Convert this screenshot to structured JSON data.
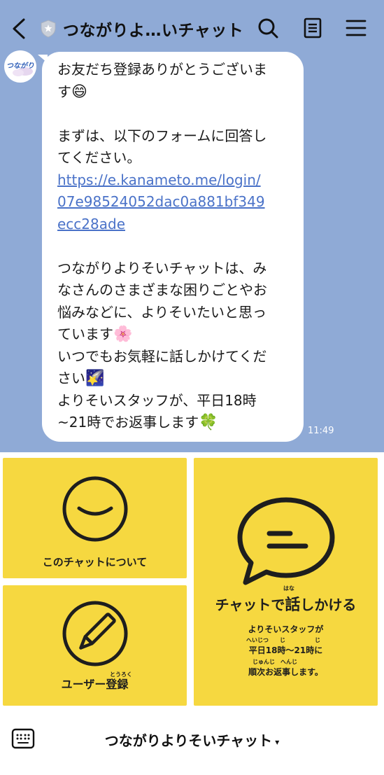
{
  "header": {
    "title": "つながりよ…いチャット"
  },
  "avatar": {
    "text": "つながり"
  },
  "message": {
    "line_greeting": "お友だち登録ありがとうございま",
    "line_greeting_2": "す",
    "line_form_1": "まずは、以下のフォームに回答し",
    "line_form_2": "てください。",
    "link_1": "https://e.kanameto.me/login/",
    "link_2": "07e98524052dac0a881bf349",
    "link_3": "ecc28ade",
    "line_p1": "つながりよりそいチャットは、み",
    "line_p2": "なさんのさまざまな困りごとやお",
    "line_p3": "悩みなどに、よりそいたいと思っ",
    "line_p4": "ています",
    "line_p5": "いつでもお気軽に話しかけてくだ",
    "line_p6": "さい",
    "line_p7": "よりそいスタッフが、平日18時",
    "line_p8": "~21時でお返事します",
    "time": "11:49"
  },
  "menu": {
    "about": {
      "label": "このチャットについて"
    },
    "register": {
      "label": "ユーザー登録",
      "ruby": "とうろく"
    },
    "talk": {
      "label_a": "チャットで",
      "label_b": "話",
      "label_c": "しかける",
      "ruby_b": "はな",
      "sub_1": "よりそいスタッフが",
      "sub_2": "平日18時～21時に",
      "sub_3": "順次お返事します。",
      "ruby_heijitsu": "へいじつ",
      "ruby_ji1": "じ",
      "ruby_ji2": "じ",
      "ruby_junji": "じゅんじ",
      "ruby_henji": "へんじ"
    }
  },
  "bottom": {
    "title": "つながりよりそいチャット",
    "caret": "▾"
  },
  "colors": {
    "chat_bg": "#8faad6",
    "tile_yellow": "#f6d840",
    "link": "#4a72c8"
  }
}
